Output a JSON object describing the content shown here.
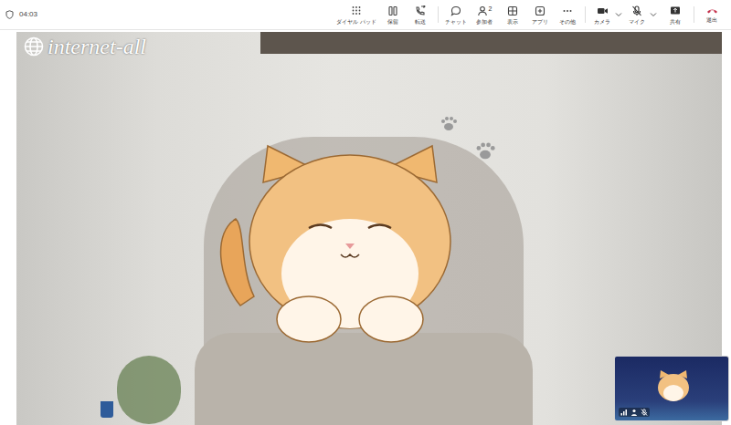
{
  "call": {
    "timer": "04:03"
  },
  "toolbar": {
    "items": [
      {
        "label": "ダイヤル パッド"
      },
      {
        "label": "保留"
      },
      {
        "label": "転送"
      },
      {
        "label": "チャット"
      },
      {
        "label": "参加者",
        "count": "2"
      },
      {
        "label": "表示"
      },
      {
        "label": "アプリ"
      },
      {
        "label": "その他"
      },
      {
        "label": "カメラ",
        "on": true
      },
      {
        "label": "マイク",
        "muted": true
      },
      {
        "label": "共有"
      },
      {
        "label": "退出"
      }
    ]
  },
  "video": {
    "watermark": "internet-all"
  },
  "self_view": {
    "mic_muted": true
  }
}
